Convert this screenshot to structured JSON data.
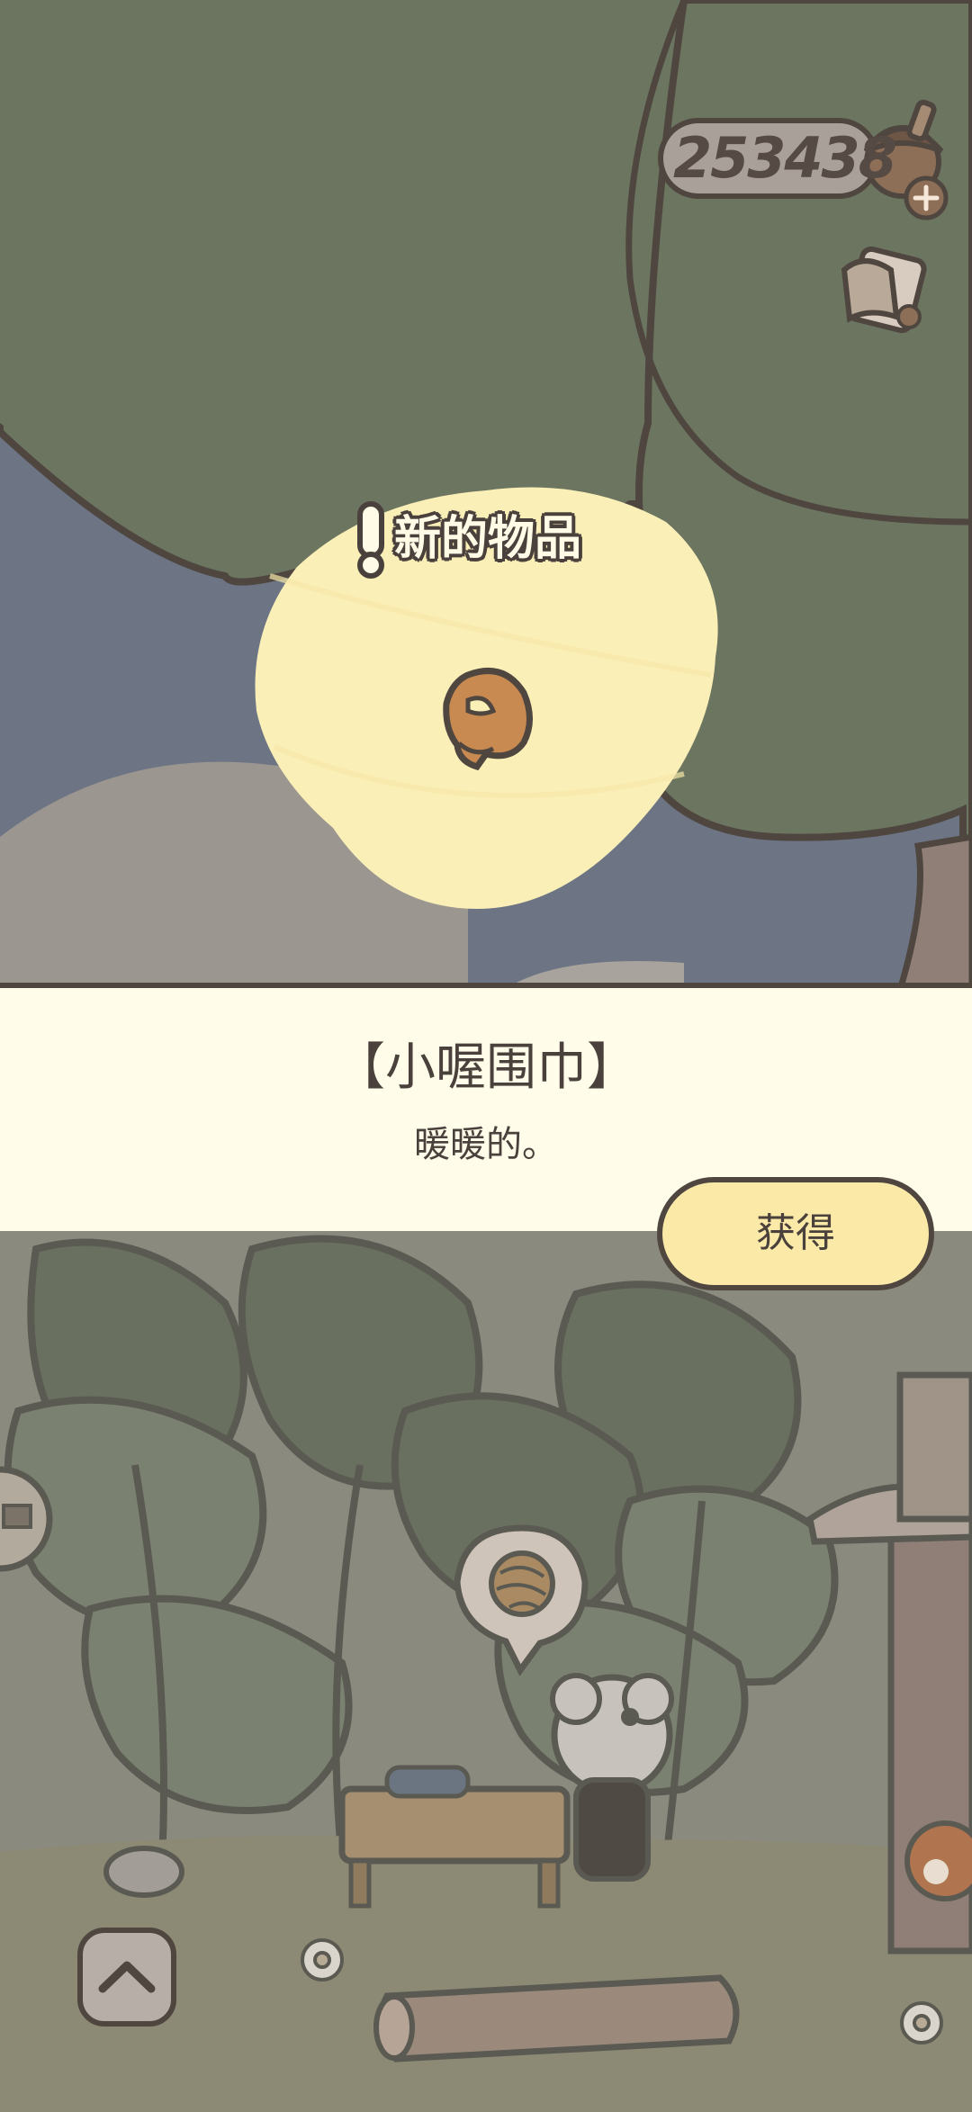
{
  "hud": {
    "currency_value": "253438",
    "currency_icon": "acorn-plus-icon",
    "letters_icon": "letters-icon"
  },
  "reward": {
    "new_item_label": "新的物品",
    "alert_icon": "exclamation-icon",
    "item_icon": "scarf-icon",
    "item_name": "【小喔围巾】",
    "item_description": "暖暖的。",
    "obtain_button_label": "获得"
  },
  "scene": {
    "thought_bubble_icon": "yarn-ball-icon",
    "back_up_icon": "chevron-up-icon"
  },
  "colors": {
    "outline": "#4f4640",
    "tree_green": "#6b7560",
    "banner_bg": "#fffde9",
    "glow": "#fbefb8",
    "button_bg": "#fbe9a8"
  }
}
